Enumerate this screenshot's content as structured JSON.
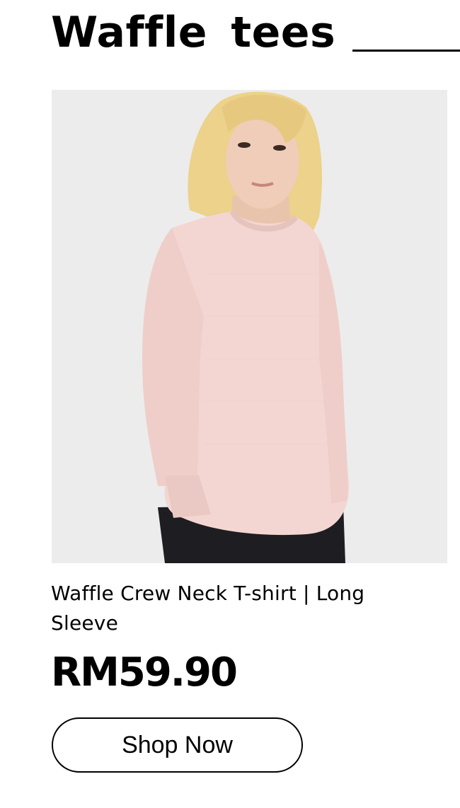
{
  "section": {
    "title": "Waffle tees"
  },
  "product": {
    "name": "Waffle Crew Neck T-shirt | Long Sleeve",
    "price": "RM59.90",
    "cta_label": "Shop Now",
    "image_icon": "product-photo",
    "colors": {
      "background": "#ececec",
      "garment": "#f3d6d2",
      "hair": "#ecd28a",
      "pants": "#1e1e22"
    }
  }
}
